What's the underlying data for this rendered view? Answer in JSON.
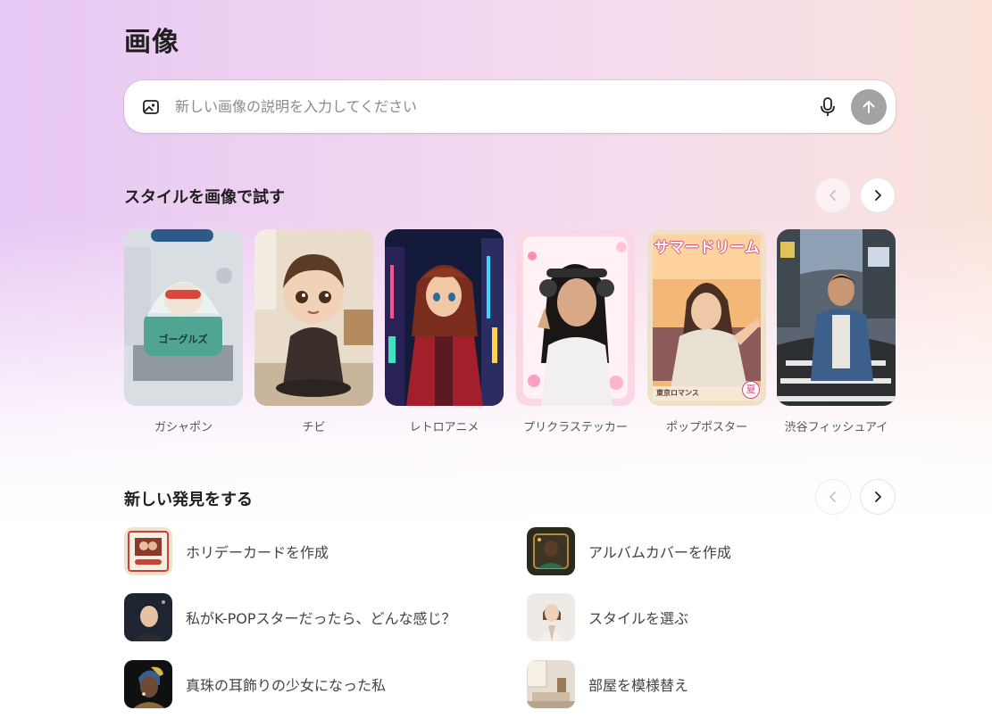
{
  "page": {
    "title": "画像"
  },
  "search": {
    "placeholder": "新しい画像の説明を入力してください",
    "icon": "image-icon",
    "mic_icon": "mic-icon",
    "send_icon": "arrow-up-icon"
  },
  "styles_section": {
    "title": "スタイルを画像で試す",
    "items": [
      {
        "label": "ガシャポン"
      },
      {
        "label": "チビ"
      },
      {
        "label": "レトロアニメ"
      },
      {
        "label": "プリクラステッカー"
      },
      {
        "label": "ポップポスター",
        "poster_title": "サマードリーム",
        "poster_caption": "東京ロマンス",
        "poster_badge": "夏"
      },
      {
        "label": "渋谷フィッシュアイ"
      }
    ]
  },
  "discover_section": {
    "title": "新しい発見をする",
    "items": [
      {
        "label": "ホリデーカードを作成"
      },
      {
        "label": "アルバムカバーを作成"
      },
      {
        "label": "私がK-POPスターだったら、どんな感じ？"
      },
      {
        "label": "スタイルを選ぶ"
      },
      {
        "label": "真珠の耳飾りの少女になった私"
      },
      {
        "label": "部屋を模様替え"
      }
    ]
  },
  "colors": {
    "accent_send": "#a3a3a3",
    "text": "#1f1f1f",
    "muted": "#555555"
  }
}
